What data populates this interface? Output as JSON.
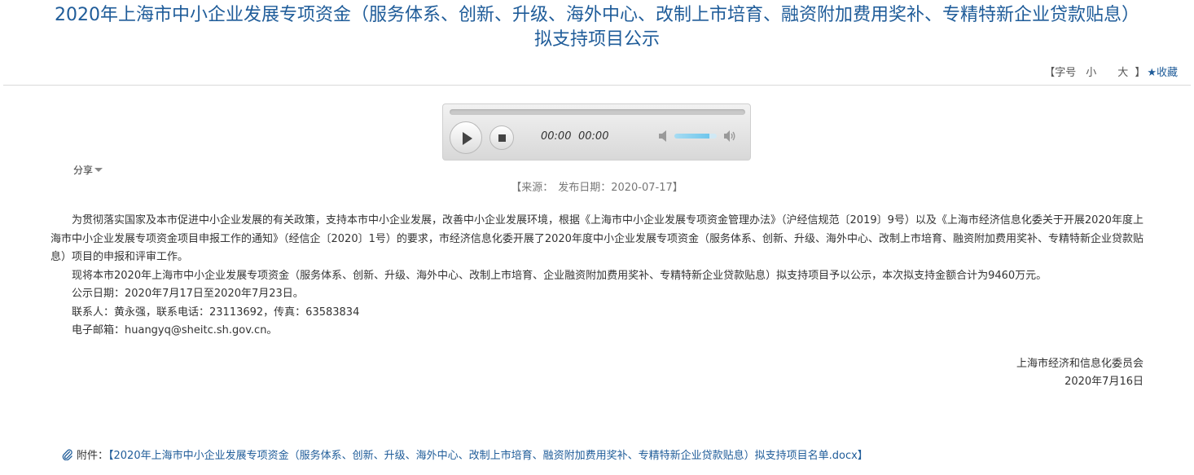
{
  "header": {
    "title_line1": "2020年上海市中小企业发展专项资金（服务体系、创新、升级、海外中心、改制上市培育、融资附加费用奖补、专精特新企业贷款贴息）",
    "title_line2": "拟支持项目公示"
  },
  "tools": {
    "font_label": "【字号",
    "font_small": "小",
    "font_large": "大",
    "bracket_close": "】",
    "favorite_icon": "star-icon",
    "favorite_label": "收藏"
  },
  "player": {
    "current_time": "00:00",
    "duration": "00:00",
    "volume_level": 0.82,
    "play_icon": "play-icon",
    "stop_icon": "stop-icon",
    "mute_icon": "speaker-mute-icon",
    "max_volume_icon": "speaker-max-icon"
  },
  "share": {
    "label": "分享",
    "caret_icon": "caret-down-icon"
  },
  "meta": {
    "source_label": "【来源：",
    "publish_label": "发布日期：2020-07-17】"
  },
  "content": {
    "paragraphs": [
      "为贯彻落实国家及本市促进中小企业发展的有关政策，支持本市中小企业发展，改善中小企业发展环境，根据《上海市中小企业发展专项资金管理办法》（沪经信规范〔2019〕9号）以及《上海市经济信息化委关于开展2020年度上海市中小企业发展专项资金项目申报工作的通知》（经信企〔2020〕1号）的要求，市经济信息化委开展了2020年度中小企业发展专项资金（服务体系、创新、升级、海外中心、改制上市培育、融资附加费用奖补、专精特新企业贷款贴息）项目的申报和评审工作。",
      "现将本市2020年上海市中小企业发展专项资金（服务体系、创新、升级、海外中心、改制上市培育、企业融资附加费用奖补、专精特新企业贷款贴息）拟支持项目予以公示，本次拟支持金额合计为9460万元。",
      "公示日期：2020年7月17日至2020年7月23日。",
      "联系人：黄永强，联系电话：23113692，传真：63583834",
      "电子邮箱：huangyq@sheitc.sh.gov.cn。"
    ],
    "signature_org": "上海市经济和信息化委员会",
    "signature_date": "2020年7月16日"
  },
  "attachment": {
    "icon": "paperclip-icon",
    "label": "附件：",
    "link_text": "【2020年上海市中小企业发展专项资金（服务体系、创新、升级、海外中心、改制上市培育、融资附加费用奖补、专精特新企业贷款贴息）拟支持项目名单.docx】"
  }
}
